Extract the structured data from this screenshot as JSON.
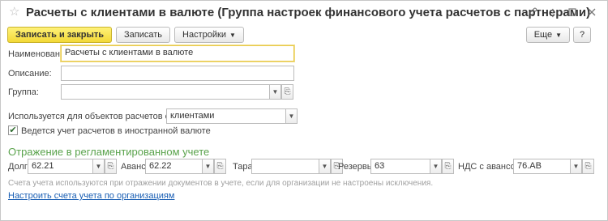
{
  "window": {
    "title": "Расчеты с клиентами в валюте (Группа настроек финансового учета расчетов с партнерами)",
    "icons": [
      "link-icon",
      "more-icon",
      "maximize-icon",
      "close-icon"
    ]
  },
  "toolbar": {
    "save_close_label": "Записать и закрыть",
    "save_label": "Записать",
    "settings_label": "Настройки",
    "more_label": "Еще",
    "help_label": "?"
  },
  "form": {
    "name_label": "Наименование:",
    "name_value": "Расчеты с клиентами в валюте",
    "description_label": "Описание:",
    "description_value": "",
    "group_label": "Группа:",
    "group_value": "",
    "used_for_label": "Используется для объектов расчетов с:",
    "used_for_value": "клиентами",
    "foreign_currency_label": "Ведется учет расчетов в иностранной валюте",
    "foreign_currency_checked": true
  },
  "section": {
    "title": "Отражение в регламентированном учете",
    "debt_label": "Долг:",
    "debt_value": "62.21",
    "advances_label": "Авансы:",
    "advances_value": "62.22",
    "container_label": "Тара:",
    "container_value": "",
    "reserves_label": "Резервы:",
    "reserves_value": "63",
    "vat_label": "НДС с авансов:",
    "vat_value": "76.АВ",
    "note": "Счета учета используются при отражении документов в учете, если для организации не настроены исключения.",
    "link": "Настроить счета учета по организациям"
  }
}
